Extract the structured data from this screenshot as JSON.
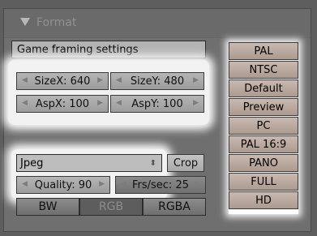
{
  "panel": {
    "title": "Format"
  },
  "game_framing": {
    "label": "Game framing settings"
  },
  "size_aspect": {
    "size_x": "SizeX: 640",
    "size_y": "SizeY: 480",
    "asp_x": "AspX: 100",
    "asp_y": "AspY: 100"
  },
  "format": {
    "selected": "Jpeg",
    "crop_label": "Crop",
    "quality": "Quality: 90",
    "frs_sec": "Frs/sec: 25"
  },
  "color_mode": {
    "options": [
      "BW",
      "RGB",
      "RGBA"
    ],
    "selected": "RGB"
  },
  "presets": [
    "PAL",
    "NTSC",
    "Default",
    "Preview",
    "PC",
    "PAL 16:9",
    "PANO",
    "FULL",
    "HD"
  ],
  "colors": {
    "panel_bg": "#6f6f6f",
    "preset_bg": "#c0ae9f",
    "selected_seg": "#5d5d5d",
    "highlight": "#f2f2f2"
  }
}
